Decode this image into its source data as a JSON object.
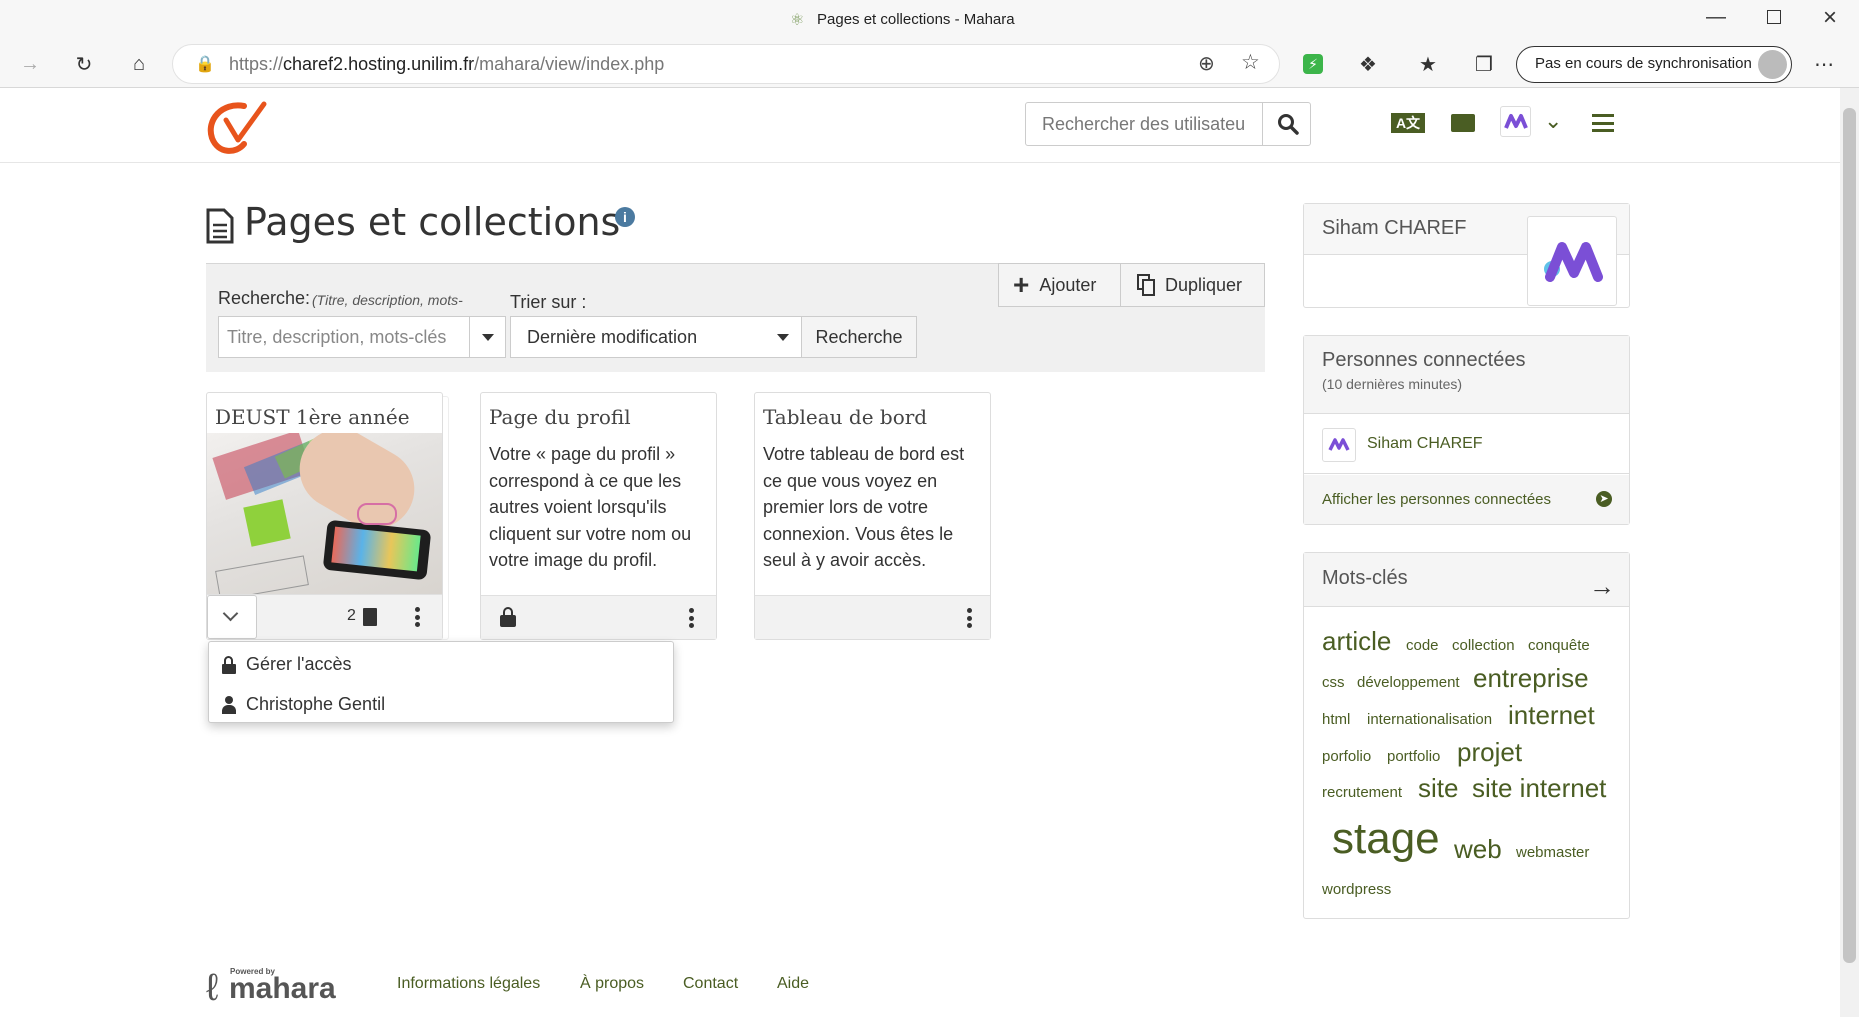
{
  "browser": {
    "window_title": "Pages et collections - Mahara",
    "url_prefix": "https://",
    "url_host": "charef2.hosting.unilim.fr",
    "url_path": "/mahara/view/index.php",
    "sync_label": "Pas en cours de synchronisation"
  },
  "header": {
    "user_search_placeholder": "Rechercher des utilisateu"
  },
  "page": {
    "title": "Pages et collections"
  },
  "search": {
    "label": "Recherche:",
    "hint": "(Titre, description, mots-",
    "placeholder": "Titre, description, mots-clés",
    "sort_label": "Trier sur :",
    "sort_value": "Dernière modification",
    "submit_label": "Recherche",
    "add_label": "Ajouter",
    "duplicate_label": "Dupliquer"
  },
  "cards": [
    {
      "title": "DEUST 1ère année",
      "count": "2",
      "image_alt": "photo bureau"
    },
    {
      "title": "Page du profil",
      "description": "Votre « page du profil » correspond à ce que les autres voient lorsqu'ils cliquent sur votre nom ou votre image du profil."
    },
    {
      "title": "Tableau de bord",
      "description": "Votre tableau de bord est ce que vous voyez en premier lors de votre connexion. Vous êtes le seul à y avoir accès."
    }
  ],
  "access_menu": {
    "items": [
      "Gérer l'accès",
      "Christophe Gentil"
    ]
  },
  "sidebar": {
    "profile_name": "Siham CHAREF",
    "online_title": "Personnes connectées",
    "online_subtitle": "(10 dernières minutes)",
    "online_user": "Siham CHAREF",
    "online_link": "Afficher les personnes connectées",
    "tags_title": "Mots-clés",
    "tags": [
      "article",
      "code",
      "collection",
      "conquête",
      "css",
      "développement",
      "entreprise",
      "html",
      "internationalisation",
      "internet",
      "porfolio",
      "portfolio",
      "projet",
      "recrutement",
      "site",
      "site internet",
      "stage",
      "web",
      "webmaster",
      "wordpress"
    ]
  },
  "footer": {
    "powered_by": "Powered by",
    "brand": "mahara",
    "links": [
      "Informations légales",
      "À propos",
      "Contact",
      "Aide"
    ]
  },
  "colors": {
    "accent_green": "#4a5d23",
    "logo_orange": "#e8541c",
    "info_blue": "#4b7aa0"
  }
}
